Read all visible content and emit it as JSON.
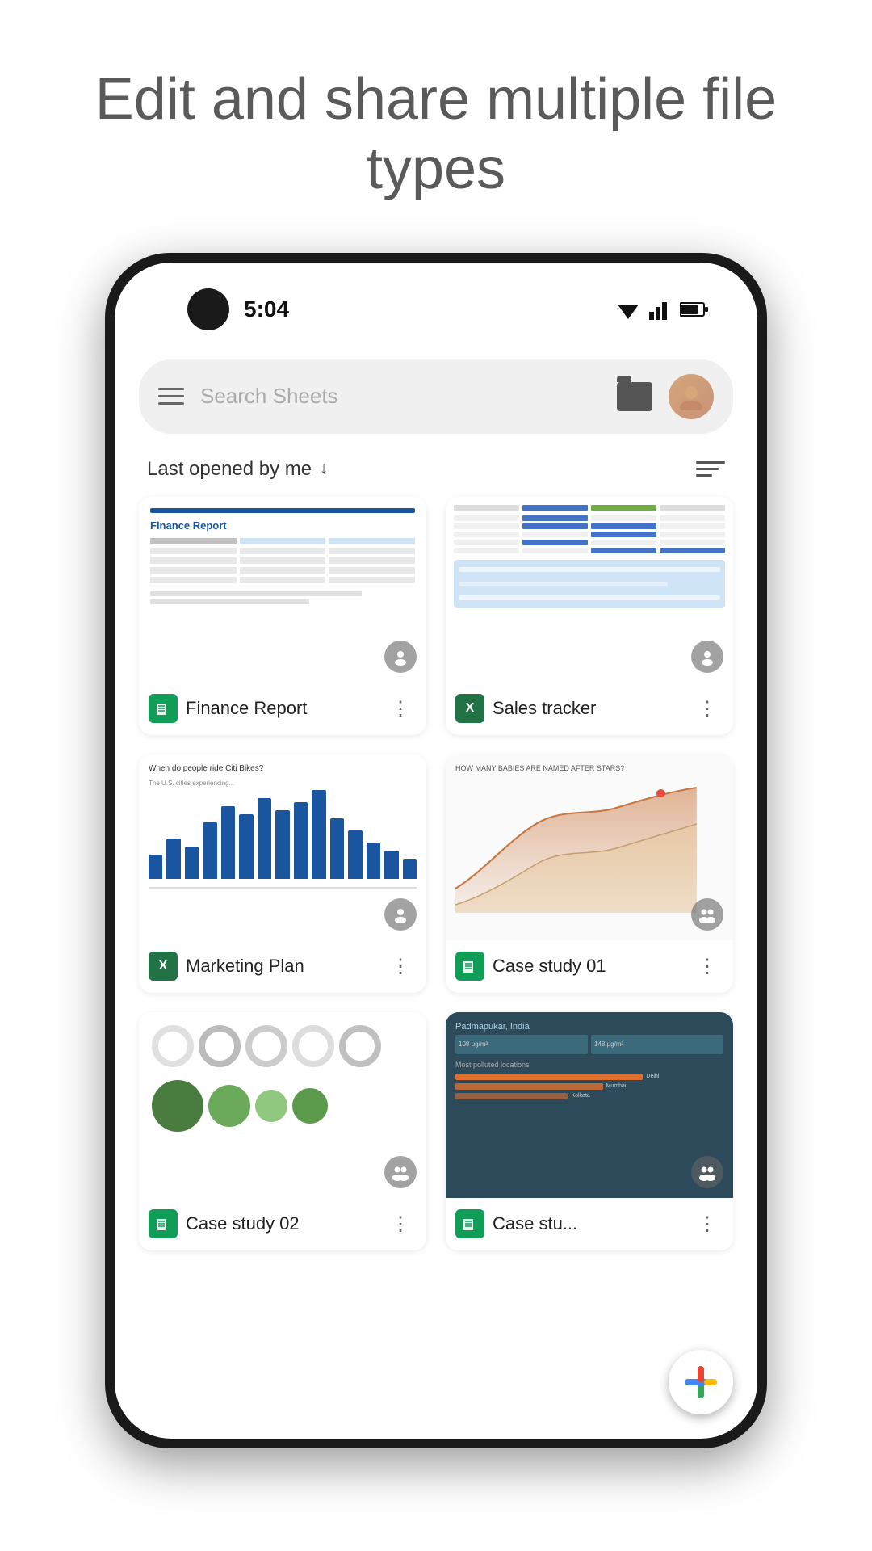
{
  "hero": {
    "title": "Edit and share multiple file types"
  },
  "status_bar": {
    "time": "5:04"
  },
  "search": {
    "placeholder": "Search Sheets"
  },
  "sort": {
    "label": "Last opened by me",
    "arrow": "↓"
  },
  "files": [
    {
      "name": "Finance Report",
      "type": "sheets",
      "badge_label": "✦",
      "thumbnail_type": "finance"
    },
    {
      "name": "Sales tracker",
      "type": "excel",
      "badge_label": "✕",
      "thumbnail_type": "sales"
    },
    {
      "name": "Marketing Plan",
      "type": "excel",
      "badge_label": "✕",
      "thumbnail_type": "marketing"
    },
    {
      "name": "Case study 01",
      "type": "sheets",
      "badge_label": "✦",
      "thumbnail_type": "case1"
    },
    {
      "name": "Case study 02",
      "type": "sheets",
      "badge_label": "✦",
      "thumbnail_type": "case2"
    },
    {
      "name": "Case stu...",
      "type": "sheets",
      "badge_label": "✦",
      "thumbnail_type": "case3"
    }
  ],
  "fab": {
    "label": "+"
  },
  "icons": {
    "menu": "☰",
    "dots_vertical": "⋮",
    "list_view": "≡",
    "shared_person": "👤"
  }
}
